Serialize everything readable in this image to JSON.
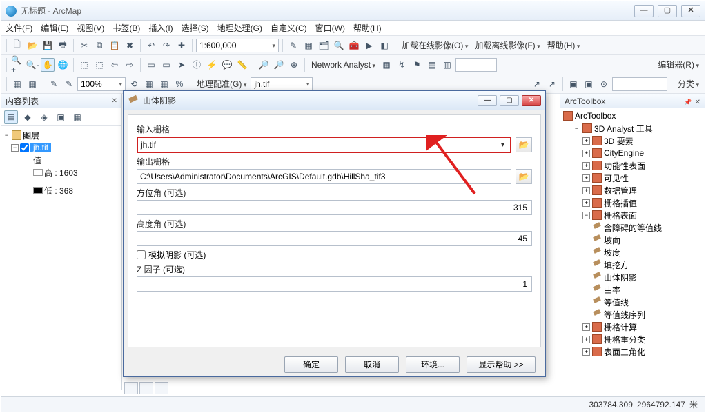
{
  "window": {
    "title": "无标题 - ArcMap"
  },
  "menu": {
    "file": "文件(F)",
    "edit": "编辑(E)",
    "view": "视图(V)",
    "bookmarks": "书签(B)",
    "insert": "插入(I)",
    "select": "选择(S)",
    "geoproc": "地理处理(G)",
    "customize": "自定义(C)",
    "window": "窗口(W)",
    "help": "帮助(H)"
  },
  "toolbar1": {
    "scale": "1:600,000",
    "online_img": "加载在线影像(O)",
    "offline_img": "加载离线影像(F)",
    "help": "帮助(H)"
  },
  "toolbar2": {
    "na": "Network Analyst",
    "editor": "编辑器(R)"
  },
  "toolbar3": {
    "zoom": "100%",
    "georef": "地理配准(G)",
    "georef_layer": "jh.tif",
    "classify": "分类"
  },
  "toc": {
    "title": "内容列表",
    "root": "图层",
    "layer": "jh.tif",
    "value_label": "值",
    "high": "高 : 1603",
    "low": "低 : 368"
  },
  "toolbox": {
    "title": "ArcToolbox",
    "root": "ArcToolbox",
    "group": "3D Analyst 工具",
    "items": [
      "3D 要素",
      "CityEngine",
      "功能性表面",
      "可见性",
      "数据管理",
      "栅格插值"
    ],
    "raster_surface": "栅格表面",
    "rs_tools": [
      "含障碍的等值线",
      "坡向",
      "坡度",
      "填挖方",
      "山体阴影",
      "曲率",
      "等值线",
      "等值线序列"
    ],
    "tail": [
      "栅格计算",
      "栅格重分类",
      "表面三角化"
    ]
  },
  "dialog": {
    "title": "山体阴影",
    "lbl_in": "输入栅格",
    "val_in": "jh.tif",
    "lbl_out": "输出栅格",
    "val_out": "C:\\Users\\Administrator\\Documents\\ArcGIS\\Default.gdb\\HillSha_tif3",
    "lbl_az": "方位角 (可选)",
    "val_az": "315",
    "lbl_alt": "高度角 (可选)",
    "val_alt": "45",
    "lbl_model": "模拟阴影 (可选)",
    "lbl_z": "Z 因子 (可选)",
    "val_z": "1",
    "btn_ok": "确定",
    "btn_cancel": "取消",
    "btn_env": "环境...",
    "btn_help": "显示帮助 >>"
  },
  "status": {
    "x": "303784.309",
    "y": "2964792.147",
    "unit": "米"
  }
}
